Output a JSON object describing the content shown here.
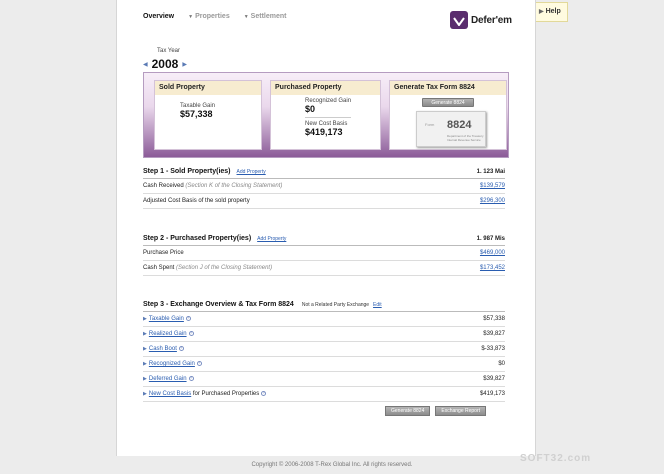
{
  "nav": {
    "items": [
      {
        "label": "Overview",
        "active": true
      },
      {
        "label": "Properties",
        "active": false
      },
      {
        "label": "Settlement",
        "active": false
      }
    ]
  },
  "logo": {
    "name": "Defer'em"
  },
  "help": {
    "label": "Help"
  },
  "tax_year": {
    "label": "Tax Year",
    "value": "2008"
  },
  "cards": {
    "sold": {
      "title": "Sold Property",
      "gain_label": "Taxable Gain",
      "gain_value": "$57,338"
    },
    "purchased": {
      "title": "Purchased Property",
      "recognized_label": "Recognized Gain",
      "recognized_value": "$0",
      "basis_label": "New Cost Basis",
      "basis_value": "$419,173"
    },
    "generate": {
      "title": "Generate Tax Form 8824",
      "button": "Generate 8824",
      "form_number": "8824",
      "form_prefix": "Form",
      "form_caption": "Department of the Treasury Internal Revenue Service"
    }
  },
  "step1": {
    "title": "Step 1 - Sold Property(ies)",
    "add": "Add Property",
    "right": "1. 123 Mai",
    "rows": [
      {
        "label": "Cash Received",
        "note": "(Section K of the Closing Statement)",
        "value": "$139,579"
      },
      {
        "label": "Adjusted Cost Basis of the sold property",
        "note": "",
        "value": "$296,300"
      }
    ]
  },
  "step2": {
    "title": "Step 2 - Purchased Property(ies)",
    "add": "Add Property",
    "right": "1. 987 Mis",
    "rows": [
      {
        "label": "Purchase Price",
        "note": "",
        "value": "$469,000"
      },
      {
        "label": "Cash Spent",
        "note": "(Section J of the Closing Statement)",
        "value": "$173,452"
      }
    ]
  },
  "step3": {
    "title": "Step 3 - Exchange Overview & Tax Form 8824",
    "sub": "Not a Related Party Exchange",
    "edit": "Edit",
    "rows": [
      {
        "label": "Taxable Gain",
        "suffix": "",
        "value": "$57,338"
      },
      {
        "label": "Realized Gain",
        "suffix": "",
        "value": "$39,827"
      },
      {
        "label": "Cash Boot",
        "suffix": "",
        "value": "$-33,873"
      },
      {
        "label": "Recognized Gain",
        "suffix": "",
        "value": "$0"
      },
      {
        "label": "Deferred Gain",
        "suffix": "",
        "value": "$39,827"
      },
      {
        "label": "New Cost Basis",
        "suffix": " for Purchased Properties",
        "value": "$419,173"
      }
    ],
    "buttons": {
      "generate": "Generate 8824",
      "report": "Exchange Report"
    }
  },
  "footer": {
    "copyright": "Copyright © 2006-2008 T-Rex Global Inc. All rights reserved."
  },
  "watermark": "SOFT32.com"
}
